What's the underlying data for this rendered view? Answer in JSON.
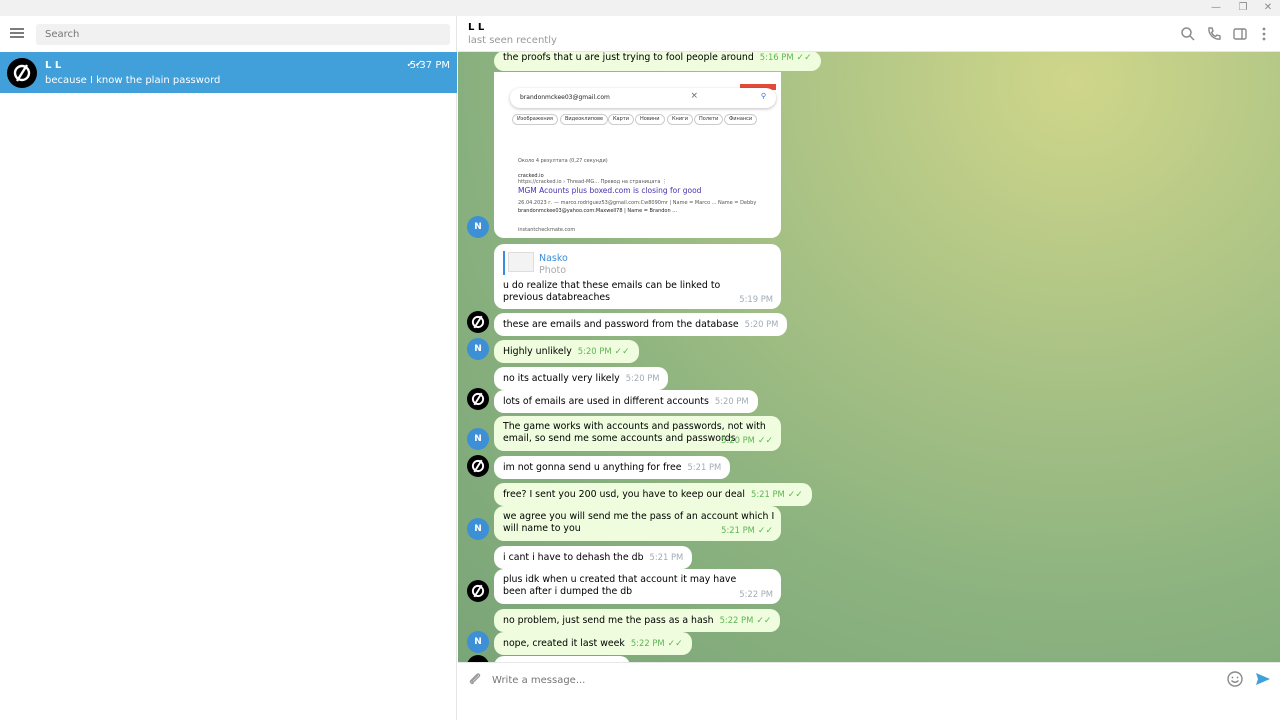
{
  "window": {
    "minimize_glyph": "—",
    "restore_glyph": "❐",
    "close_glyph": "✕"
  },
  "sidebar": {
    "search_placeholder": "Search",
    "dialog": {
      "name": "L L",
      "preview": "because I know the plain password",
      "time": "5:37 PM",
      "ticks": "✓✓"
    }
  },
  "header": {
    "peer_name": "L L",
    "peer_status": "last seen recently"
  },
  "photo_screenshot": {
    "query": "brandonmckee03@gmail.com",
    "chips": [
      "Изображения",
      "Видеоклипове",
      "Карти",
      "Новини",
      "Книги",
      "Полети",
      "Финанси"
    ],
    "result_count": "Около 4 резултата (0,27 секунди)",
    "site_name": "cracked.io",
    "site_url": "https://cracked.io › Thread-MG...   Превод на страницата  ⋮",
    "result_title": "MGM Acounts plus boxed.com is closing for good",
    "snippet1": "26.04.2023 г. — marco.rodriguez53@gmail.com:Cw8090mr | Name = Marco ... Name = Debby",
    "snippet2": "brandonmckee03@yahoo.com:Maxwell78 | Name = Brandon ...",
    "snippet3": "instantcheckmate.com"
  },
  "reply": {
    "name": "Nasko",
    "type": "Photo"
  },
  "messages": [
    {
      "text": "the proofs that u are just trying to fool people around",
      "time": "5:16 PM"
    },
    {
      "text": "u do realize that these emails can be linked to previous databreaches",
      "time": "5:19 PM"
    },
    {
      "text": "these are emails and password from the database",
      "time": "5:20 PM"
    },
    {
      "text": "Highly unlikely",
      "time": "5:20 PM"
    },
    {
      "text": "no its actually very likely",
      "time": "5:20 PM"
    },
    {
      "text": "lots of emails are used in different accounts",
      "time": "5:20 PM"
    },
    {
      "text": "The game works with accounts and passwords, not with email, so send me some accounts and passwords",
      "time": "5:20 PM"
    },
    {
      "text": "im not gonna send u anything for free",
      "time": "5:21 PM"
    },
    {
      "text": "free? I sent you 200 usd, you have to keep our deal",
      "time": "5:21 PM"
    },
    {
      "text": "we agree you will send me the pass of an account which I will name to you",
      "time": "5:21 PM"
    },
    {
      "text": "i cant i have to dehash the db",
      "time": "5:21 PM"
    },
    {
      "text": "plus idk when u created that account it may have been after i dumped the db",
      "time": "5:22 PM"
    },
    {
      "text": "no problem, just send me the pass as a hash",
      "time": "5:22 PM"
    },
    {
      "text": "nope, created it last week",
      "time": "5:22 PM"
    }
  ],
  "ticks": "✓✓",
  "avatar_initial": "N",
  "composer": {
    "placeholder": "Write a message..."
  },
  "colors": {
    "accent": "#419fd9",
    "outgoing_bubble": "#effdde",
    "incoming_bubble": "#ffffff",
    "check": "#5fb555"
  }
}
